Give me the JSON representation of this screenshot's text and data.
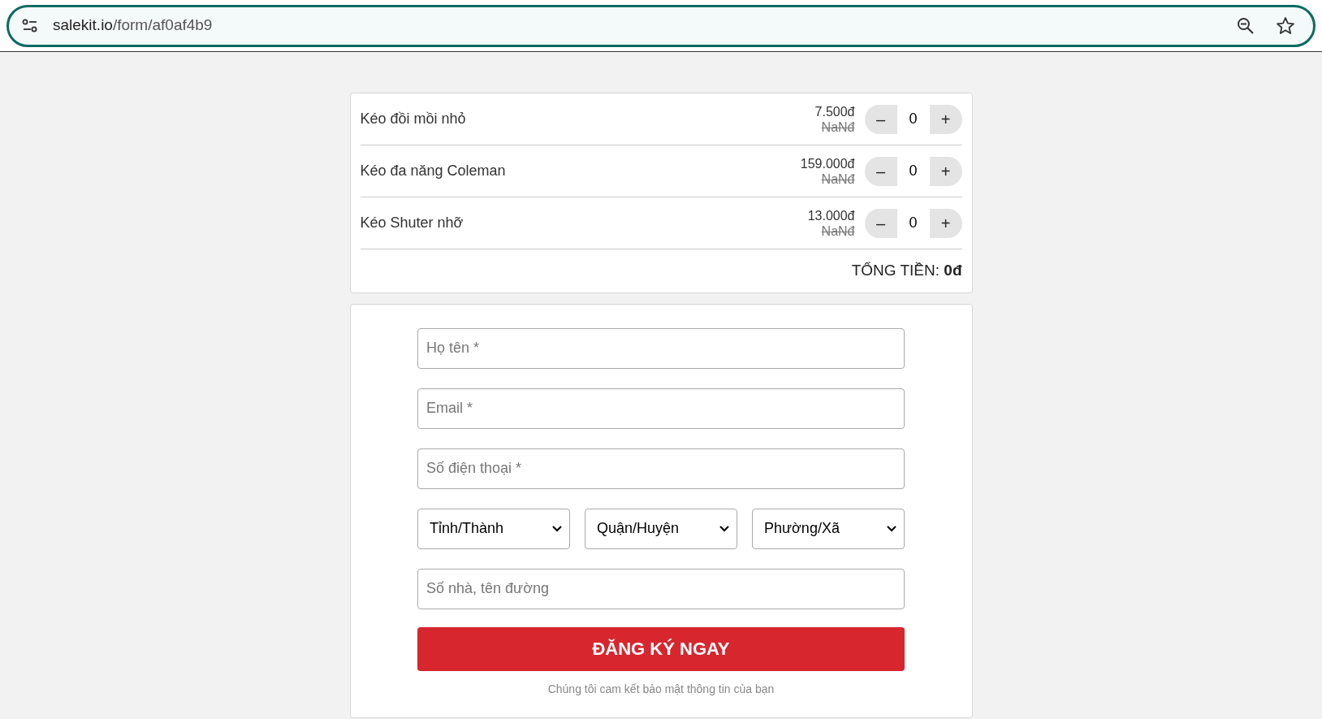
{
  "browser": {
    "url_host": "salekit.io",
    "url_path": "/form/af0af4b9"
  },
  "products": [
    {
      "name": "Kéo đồi mồi nhỏ",
      "price": "7.500đ",
      "old_price": "NaNđ",
      "quantity": "0",
      "minus": "–",
      "plus": "+"
    },
    {
      "name": "Kéo đa năng Coleman",
      "price": "159.000đ",
      "old_price": "NaNđ",
      "quantity": "0",
      "minus": "–",
      "plus": "+"
    },
    {
      "name": "Kéo Shuter nhỡ",
      "price": "13.000đ",
      "old_price": "NaNđ",
      "quantity": "0",
      "minus": "–",
      "plus": "+"
    }
  ],
  "total": {
    "label": "TỔNG TIỀN: **0đ**"
  },
  "form": {
    "fields": [
      {
        "kind": "text",
        "placeholder": "Họ tên *"
      },
      {
        "kind": "text",
        "placeholder": "Email *"
      },
      {
        "kind": "text",
        "placeholder": "Số điện thoại *"
      },
      {
        "kind": "selects",
        "options": [
          "Tỉnh/Thành",
          "Quận/Huyện",
          "Phường/Xã"
        ]
      },
      {
        "kind": "text",
        "placeholder": "Số nhà, tên đường"
      }
    ],
    "submit": "ĐĂNG KÝ NGAY",
    "note": "Chúng tôi cam kết bảo mật thông tin của bạn"
  }
}
